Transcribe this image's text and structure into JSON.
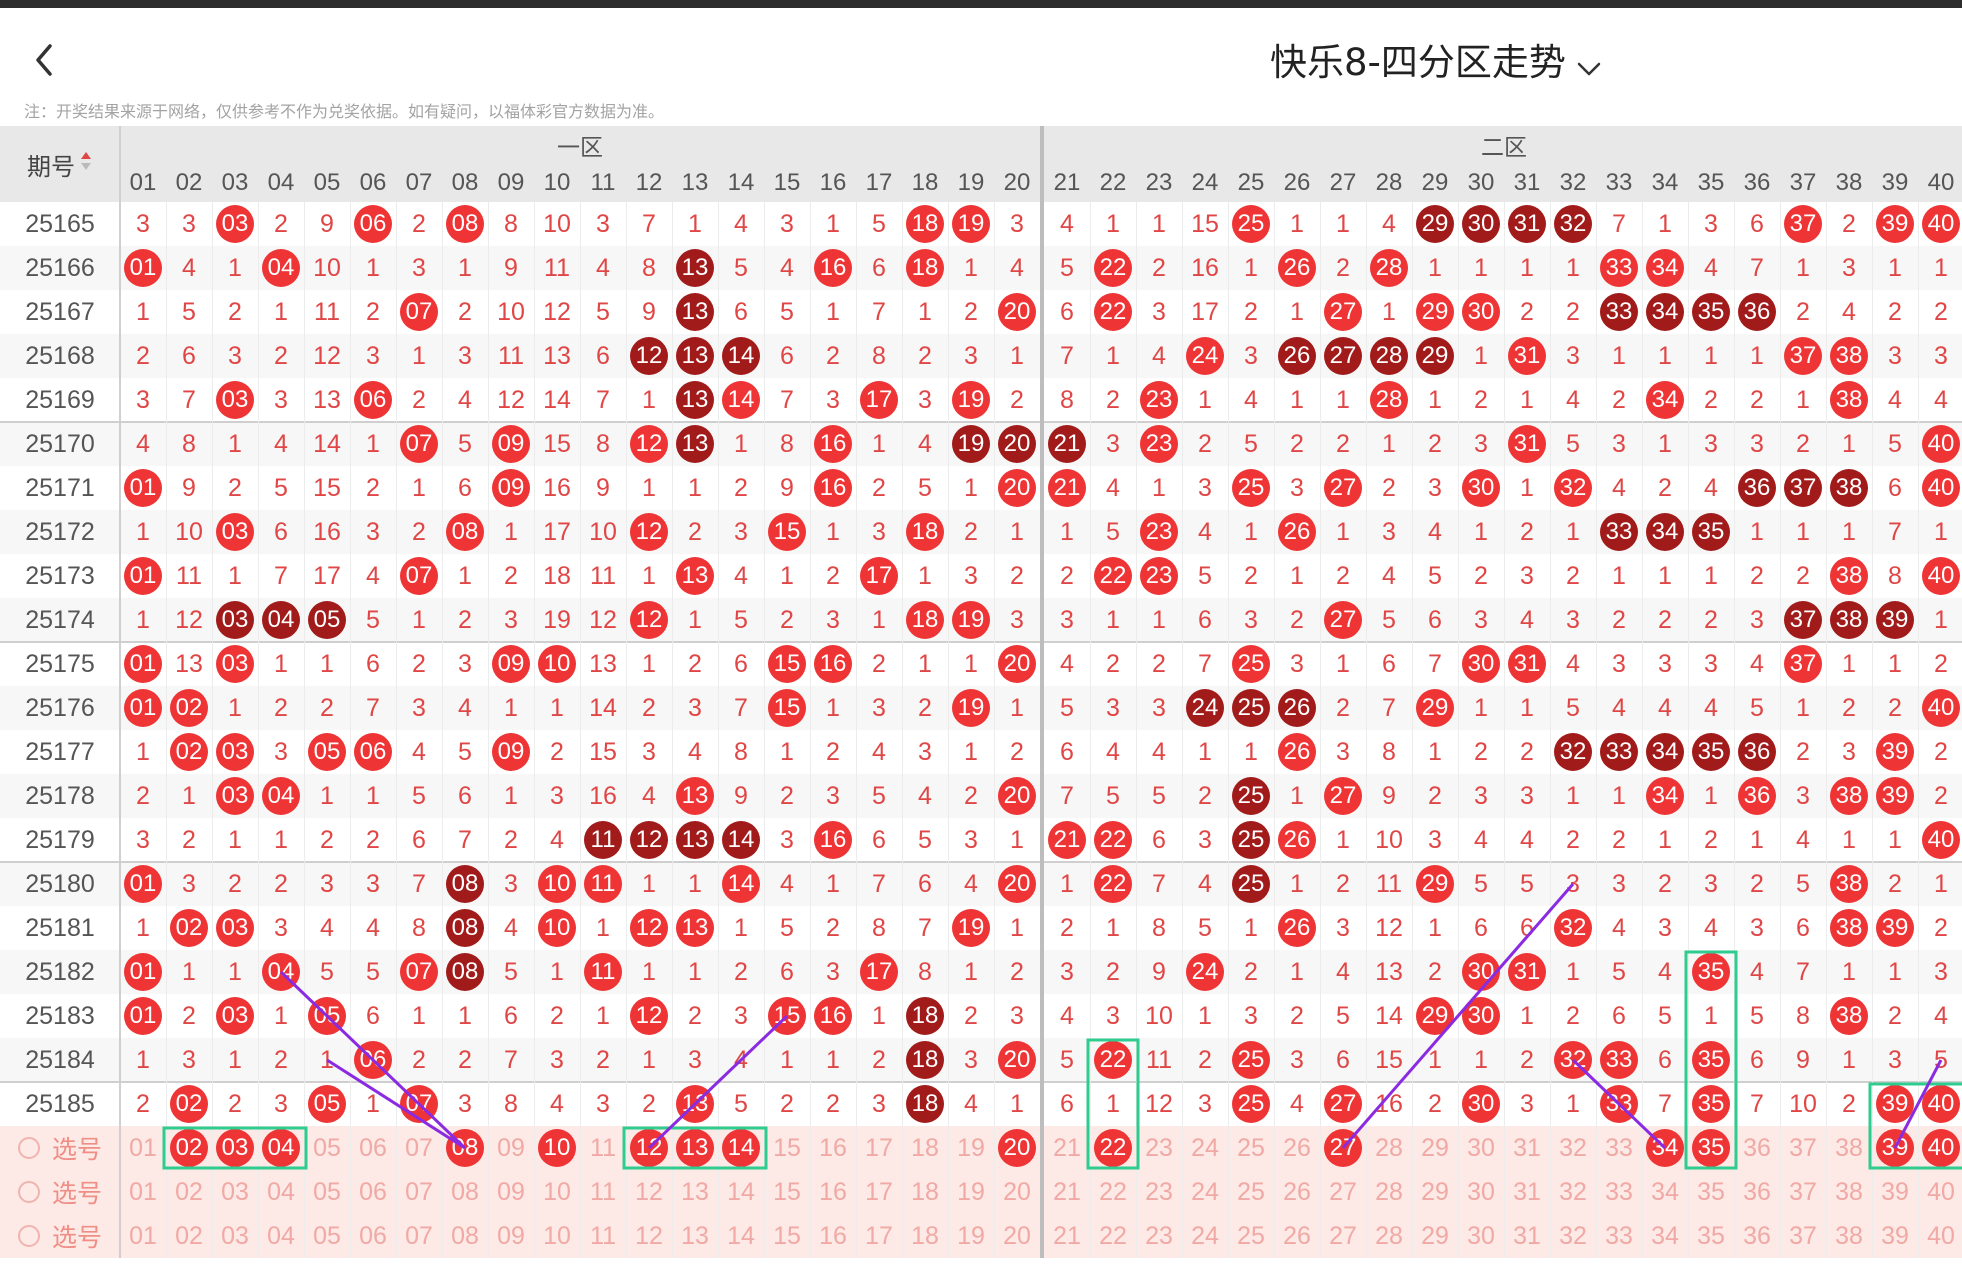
{
  "header": {
    "title": "快乐8-四分区走势",
    "back_icon": "chevron-left-icon",
    "dropdown_icon": "chevron-down-icon"
  },
  "note": "注：开奖结果来源于网络，仅供参考不作为兑奖依据。如有疑问，以福体彩官方数据为准。",
  "table": {
    "period_header": "期号",
    "sort_icon": "sort-updown-icon",
    "zones": [
      "一区",
      "二区"
    ],
    "numbers": [
      "01",
      "02",
      "03",
      "04",
      "05",
      "06",
      "07",
      "08",
      "09",
      "10",
      "11",
      "12",
      "13",
      "14",
      "15",
      "16",
      "17",
      "18",
      "19",
      "20",
      "21",
      "22",
      "23",
      "24",
      "25",
      "26",
      "27",
      "28",
      "29",
      "30",
      "31",
      "32",
      "33",
      "34",
      "35",
      "36",
      "37",
      "38",
      "39",
      "40"
    ],
    "rows": [
      {
        "period": "25165",
        "cells": [
          "3",
          "3",
          "●03",
          "2",
          "9",
          "●06",
          "2",
          "●08",
          "8",
          "10",
          "3",
          "7",
          "1",
          "4",
          "3",
          "1",
          "5",
          "●18",
          "●19",
          "3",
          "4",
          "1",
          "1",
          "15",
          "●25",
          "1",
          "1",
          "4",
          "◆29",
          "◆30",
          "◆31",
          "◆32",
          "7",
          "1",
          "3",
          "6",
          "●37",
          "2",
          "●39",
          "●40"
        ]
      },
      {
        "period": "25166",
        "cells": [
          "●01",
          "4",
          "1",
          "●04",
          "10",
          "1",
          "3",
          "1",
          "9",
          "11",
          "4",
          "8",
          "◆13",
          "5",
          "4",
          "●16",
          "6",
          "●18",
          "1",
          "4",
          "5",
          "●22",
          "2",
          "16",
          "1",
          "●26",
          "2",
          "●28",
          "1",
          "1",
          "1",
          "1",
          "●33",
          "●34",
          "4",
          "7",
          "1",
          "3",
          "1",
          "1"
        ]
      },
      {
        "period": "25167",
        "cells": [
          "1",
          "5",
          "2",
          "1",
          "11",
          "2",
          "●07",
          "2",
          "10",
          "12",
          "5",
          "9",
          "◆13",
          "6",
          "5",
          "1",
          "7",
          "1",
          "2",
          "●20",
          "6",
          "●22",
          "3",
          "17",
          "2",
          "1",
          "●27",
          "1",
          "●29",
          "●30",
          "2",
          "2",
          "◆33",
          "◆34",
          "◆35",
          "◆36",
          "2",
          "4",
          "2",
          "2"
        ]
      },
      {
        "period": "25168",
        "cells": [
          "2",
          "6",
          "3",
          "2",
          "12",
          "3",
          "1",
          "3",
          "11",
          "13",
          "6",
          "◆12",
          "◆13",
          "◆14",
          "6",
          "2",
          "8",
          "2",
          "3",
          "1",
          "7",
          "1",
          "4",
          "●24",
          "3",
          "◆26",
          "◆27",
          "◆28",
          "◆29",
          "1",
          "●31",
          "3",
          "1",
          "1",
          "1",
          "1",
          "●37",
          "●38",
          "3",
          "3"
        ]
      },
      {
        "period": "25169",
        "cells": [
          "3",
          "7",
          "●03",
          "3",
          "13",
          "●06",
          "2",
          "4",
          "12",
          "14",
          "7",
          "1",
          "◆13",
          "●14",
          "7",
          "3",
          "●17",
          "3",
          "●19",
          "2",
          "8",
          "2",
          "●23",
          "1",
          "4",
          "1",
          "1",
          "●28",
          "1",
          "2",
          "1",
          "4",
          "2",
          "●34",
          "2",
          "2",
          "1",
          "●38",
          "4",
          "4"
        ]
      },
      {
        "period": "25170",
        "cells": [
          "4",
          "8",
          "1",
          "4",
          "14",
          "1",
          "●07",
          "5",
          "●09",
          "15",
          "8",
          "●12",
          "◆13",
          "1",
          "8",
          "●16",
          "1",
          "4",
          "◆19",
          "◆20",
          "◆21",
          "3",
          "●23",
          "2",
          "5",
          "2",
          "2",
          "1",
          "2",
          "3",
          "●31",
          "5",
          "3",
          "1",
          "3",
          "3",
          "2",
          "1",
          "5",
          "●40"
        ]
      },
      {
        "period": "25171",
        "cells": [
          "●01",
          "9",
          "2",
          "5",
          "15",
          "2",
          "1",
          "6",
          "●09",
          "16",
          "9",
          "1",
          "1",
          "2",
          "9",
          "●16",
          "2",
          "5",
          "1",
          "●20",
          "●21",
          "4",
          "1",
          "3",
          "●25",
          "3",
          "●27",
          "2",
          "3",
          "●30",
          "1",
          "●32",
          "4",
          "2",
          "4",
          "◆36",
          "◆37",
          "◆38",
          "6",
          "●40"
        ]
      },
      {
        "period": "25172",
        "cells": [
          "1",
          "10",
          "●03",
          "6",
          "16",
          "3",
          "2",
          "●08",
          "1",
          "17",
          "10",
          "●12",
          "2",
          "3",
          "●15",
          "1",
          "3",
          "●18",
          "2",
          "1",
          "1",
          "5",
          "●23",
          "4",
          "1",
          "●26",
          "1",
          "3",
          "4",
          "1",
          "2",
          "1",
          "◆33",
          "◆34",
          "◆35",
          "1",
          "1",
          "1",
          "7",
          "1"
        ]
      },
      {
        "period": "25173",
        "cells": [
          "●01",
          "11",
          "1",
          "7",
          "17",
          "4",
          "●07",
          "1",
          "2",
          "18",
          "11",
          "1",
          "●13",
          "4",
          "1",
          "2",
          "●17",
          "1",
          "3",
          "2",
          "2",
          "●22",
          "●23",
          "5",
          "2",
          "1",
          "2",
          "4",
          "5",
          "2",
          "3",
          "2",
          "1",
          "1",
          "1",
          "2",
          "2",
          "●38",
          "8",
          "●40"
        ]
      },
      {
        "period": "25174",
        "cells": [
          "1",
          "12",
          "◆03",
          "◆04",
          "◆05",
          "5",
          "1",
          "2",
          "3",
          "19",
          "12",
          "●12",
          "1",
          "5",
          "2",
          "3",
          "1",
          "●18",
          "●19",
          "3",
          "3",
          "1",
          "1",
          "6",
          "3",
          "2",
          "●27",
          "5",
          "6",
          "3",
          "4",
          "3",
          "2",
          "2",
          "2",
          "3",
          "◆37",
          "◆38",
          "◆39",
          "1"
        ]
      },
      {
        "period": "25175",
        "cells": [
          "●01",
          "13",
          "●03",
          "1",
          "1",
          "6",
          "2",
          "3",
          "●09",
          "●10",
          "13",
          "1",
          "2",
          "6",
          "●15",
          "●16",
          "2",
          "1",
          "1",
          "●20",
          "4",
          "2",
          "2",
          "7",
          "●25",
          "3",
          "1",
          "6",
          "7",
          "●30",
          "●31",
          "4",
          "3",
          "3",
          "3",
          "4",
          "●37",
          "1",
          "1",
          "2"
        ]
      },
      {
        "period": "25176",
        "cells": [
          "●01",
          "●02",
          "1",
          "2",
          "2",
          "7",
          "3",
          "4",
          "1",
          "1",
          "14",
          "2",
          "3",
          "7",
          "●15",
          "1",
          "3",
          "2",
          "●19",
          "1",
          "5",
          "3",
          "3",
          "◆24",
          "◆25",
          "◆26",
          "2",
          "7",
          "●29",
          "1",
          "1",
          "5",
          "4",
          "4",
          "4",
          "5",
          "1",
          "2",
          "2",
          "●40"
        ]
      },
      {
        "period": "25177",
        "cells": [
          "1",
          "●02",
          "●03",
          "3",
          "●05",
          "●06",
          "4",
          "5",
          "●09",
          "2",
          "15",
          "3",
          "4",
          "8",
          "1",
          "2",
          "4",
          "3",
          "1",
          "2",
          "6",
          "4",
          "4",
          "1",
          "1",
          "●26",
          "3",
          "8",
          "1",
          "2",
          "2",
          "◆32",
          "◆33",
          "◆34",
          "◆35",
          "◆36",
          "2",
          "3",
          "●39",
          "2"
        ]
      },
      {
        "period": "25178",
        "cells": [
          "2",
          "1",
          "●03",
          "●04",
          "1",
          "1",
          "5",
          "6",
          "1",
          "3",
          "16",
          "4",
          "●13",
          "9",
          "2",
          "3",
          "5",
          "4",
          "2",
          "●20",
          "7",
          "5",
          "5",
          "2",
          "◆25",
          "1",
          "●27",
          "9",
          "2",
          "3",
          "3",
          "1",
          "1",
          "●34",
          "1",
          "●36",
          "3",
          "●38",
          "●39",
          "2"
        ]
      },
      {
        "period": "25179",
        "cells": [
          "3",
          "2",
          "1",
          "1",
          "2",
          "2",
          "6",
          "7",
          "2",
          "4",
          "◆11",
          "◆12",
          "◆13",
          "◆14",
          "3",
          "●16",
          "6",
          "5",
          "3",
          "1",
          "●21",
          "●22",
          "6",
          "3",
          "◆25",
          "●26",
          "1",
          "10",
          "3",
          "4",
          "4",
          "2",
          "2",
          "1",
          "2",
          "1",
          "4",
          "1",
          "1",
          "●40"
        ]
      },
      {
        "period": "25180",
        "cells": [
          "●01",
          "3",
          "2",
          "2",
          "3",
          "3",
          "7",
          "◆08",
          "3",
          "●10",
          "●11",
          "1",
          "1",
          "●14",
          "4",
          "1",
          "7",
          "6",
          "4",
          "●20",
          "1",
          "●22",
          "7",
          "4",
          "◆25",
          "1",
          "2",
          "11",
          "●29",
          "5",
          "5",
          "3",
          "3",
          "2",
          "3",
          "2",
          "5",
          "●38",
          "2",
          "1"
        ]
      },
      {
        "period": "25181",
        "cells": [
          "1",
          "●02",
          "●03",
          "3",
          "4",
          "4",
          "8",
          "◆08",
          "4",
          "●10",
          "1",
          "●12",
          "●13",
          "1",
          "5",
          "2",
          "8",
          "7",
          "●19",
          "1",
          "2",
          "1",
          "8",
          "5",
          "1",
          "●26",
          "3",
          "12",
          "1",
          "6",
          "6",
          "●32",
          "4",
          "3",
          "4",
          "3",
          "6",
          "●38",
          "●39",
          "2"
        ]
      },
      {
        "period": "25182",
        "cells": [
          "●01",
          "1",
          "1",
          "●04",
          "5",
          "5",
          "●07",
          "◆08",
          "5",
          "1",
          "●11",
          "1",
          "1",
          "2",
          "6",
          "3",
          "●17",
          "8",
          "1",
          "2",
          "3",
          "2",
          "9",
          "●24",
          "2",
          "1",
          "4",
          "13",
          "2",
          "●30",
          "●31",
          "1",
          "5",
          "4",
          "●35",
          "4",
          "7",
          "1",
          "1",
          "3"
        ]
      },
      {
        "period": "25183",
        "cells": [
          "●01",
          "2",
          "●03",
          "1",
          "●05",
          "6",
          "1",
          "1",
          "6",
          "2",
          "1",
          "●12",
          "2",
          "3",
          "●15",
          "●16",
          "1",
          "◆18",
          "2",
          "3",
          "4",
          "3",
          "10",
          "1",
          "3",
          "2",
          "5",
          "14",
          "●29",
          "●30",
          "1",
          "2",
          "6",
          "5",
          "1",
          "5",
          "8",
          "●38",
          "2",
          "4"
        ]
      },
      {
        "period": "25184",
        "cells": [
          "1",
          "3",
          "1",
          "2",
          "1",
          "●06",
          "2",
          "2",
          "7",
          "3",
          "2",
          "1",
          "3",
          "4",
          "1",
          "1",
          "2",
          "◆18",
          "3",
          "●20",
          "5",
          "●22",
          "11",
          "2",
          "●25",
          "3",
          "6",
          "15",
          "1",
          "1",
          "2",
          "●32",
          "●33",
          "6",
          "●35",
          "6",
          "9",
          "1",
          "3",
          "5"
        ]
      },
      {
        "period": "25185",
        "cells": [
          "2",
          "●02",
          "2",
          "3",
          "●05",
          "1",
          "●07",
          "3",
          "8",
          "4",
          "3",
          "2",
          "●13",
          "5",
          "2",
          "2",
          "3",
          "◆18",
          "4",
          "1",
          "6",
          "1",
          "12",
          "3",
          "●25",
          "4",
          "●27",
          "16",
          "2",
          "●30",
          "3",
          "1",
          "●33",
          "7",
          "●35",
          "7",
          "10",
          "2",
          "●39",
          "●40"
        ]
      }
    ],
    "pick_label": "选号",
    "pick_rows": [
      {
        "selected": [
          "02",
          "03",
          "04",
          "08",
          "10",
          "12",
          "13",
          "14",
          "20",
          "22",
          "27",
          "34",
          "35",
          "39",
          "40"
        ]
      },
      {
        "selected": []
      },
      {
        "selected": []
      }
    ]
  },
  "colors": {
    "ball_red": "#ee3434",
    "ball_dark": "#a11b1b",
    "miss_text": "#e04646",
    "header_bg": "#e8e8e8",
    "pick_bg": "#fde9e6",
    "highlight_box": "#2ecc8f",
    "trend_line": "#8a2be2"
  }
}
